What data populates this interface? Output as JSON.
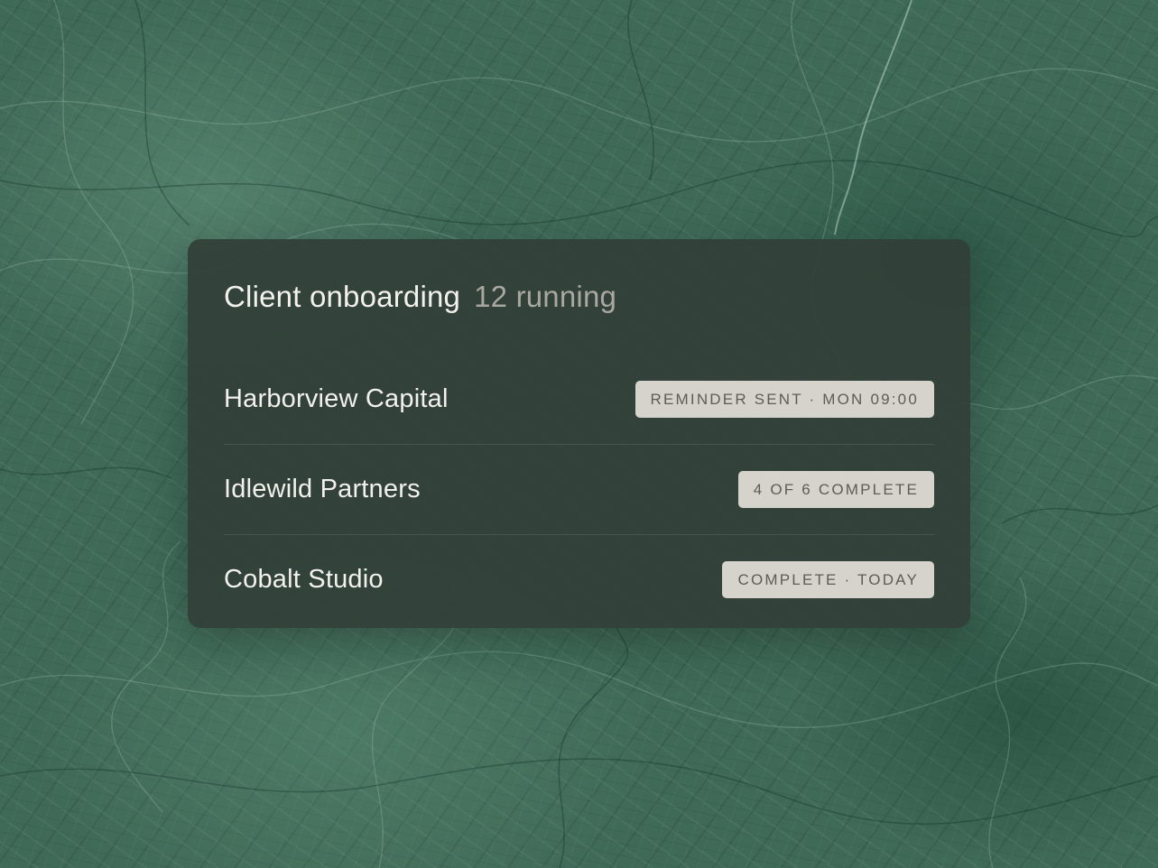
{
  "panel": {
    "title": "Client onboarding",
    "count": "12 running"
  },
  "clients": [
    {
      "name": "Harborview Capital",
      "status": "REMINDER SENT · MON 09:00"
    },
    {
      "name": "Idlewild Partners",
      "status": "4 OF 6 COMPLETE"
    },
    {
      "name": "Cobalt Studio",
      "status": "COMPLETE · TODAY"
    }
  ]
}
